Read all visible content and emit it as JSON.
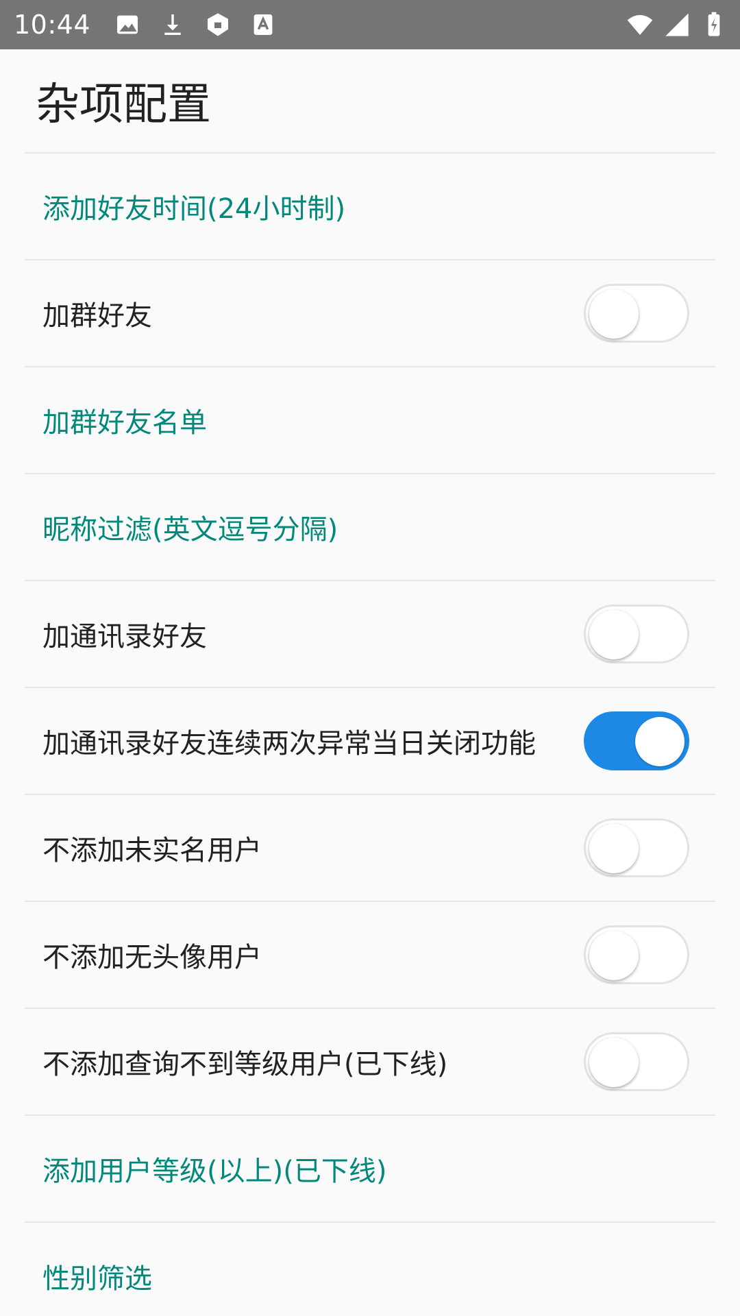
{
  "status_bar": {
    "time": "10:44",
    "icons_left": [
      "image-icon",
      "download-icon",
      "shield-icon",
      "text-a-icon"
    ],
    "icons_right": [
      "wifi-icon",
      "signal-icon",
      "battery-icon"
    ]
  },
  "page": {
    "title": "杂项配置"
  },
  "colors": {
    "accent_text": "#00897b",
    "switch_on": "#1e88e5",
    "status_bar_bg": "#757575",
    "background": "#fafafa"
  },
  "settings": {
    "items": [
      {
        "label": "添加好友时间(24小时制)",
        "type": "link"
      },
      {
        "label": "加群好友",
        "type": "switch",
        "checked": false
      },
      {
        "label": "加群好友名单",
        "type": "link"
      },
      {
        "label": "昵称过滤(英文逗号分隔)",
        "type": "link"
      },
      {
        "label": "加通讯录好友",
        "type": "switch",
        "checked": false
      },
      {
        "label": "加通讯录好友连续两次异常当日关闭功能",
        "type": "switch",
        "checked": true
      },
      {
        "label": "不添加未实名用户",
        "type": "switch",
        "checked": false
      },
      {
        "label": "不添加无头像用户",
        "type": "switch",
        "checked": false
      },
      {
        "label": "不添加查询不到等级用户(已下线)",
        "type": "switch",
        "checked": false
      },
      {
        "label": "添加用户等级(以上)(已下线)",
        "type": "link"
      },
      {
        "label": "性别筛选",
        "type": "link"
      }
    ]
  }
}
